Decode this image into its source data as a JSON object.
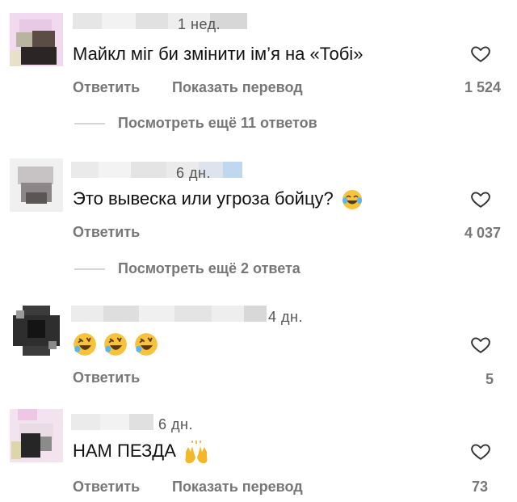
{
  "comments": [
    {
      "time": "1 нед.",
      "text": "Майкл міг би змінити ім’я на «Тобі»",
      "reply_label": "Ответить",
      "translate_label": "Показать перевод",
      "likes": "1 524",
      "more_replies": "Посмотреть ещё 11 ответов"
    },
    {
      "time": "6 дн.",
      "text": "Это вывеска или угроза бойцу?",
      "reply_label": "Ответить",
      "likes": "4 037",
      "more_replies": "Посмотреть ещё 2 ответа"
    },
    {
      "time": "4 дн.",
      "text": "",
      "reply_label": "Ответить",
      "likes": "5"
    },
    {
      "time": "6 дн.",
      "text": "НАМ ПЕЗДА",
      "reply_label": "Ответить",
      "translate_label": "Показать перевод",
      "likes": "73"
    }
  ],
  "icons": {
    "like": "heart-outline-icon",
    "laugh": "face-with-tears-of-joy-emoji",
    "rofl": "rolling-on-the-floor-laughing-emoji",
    "raised_hands": "raising-hands-emoji"
  },
  "colors": {
    "text": "#111111",
    "secondary": "#777777",
    "divider": "#d6d6d6"
  }
}
